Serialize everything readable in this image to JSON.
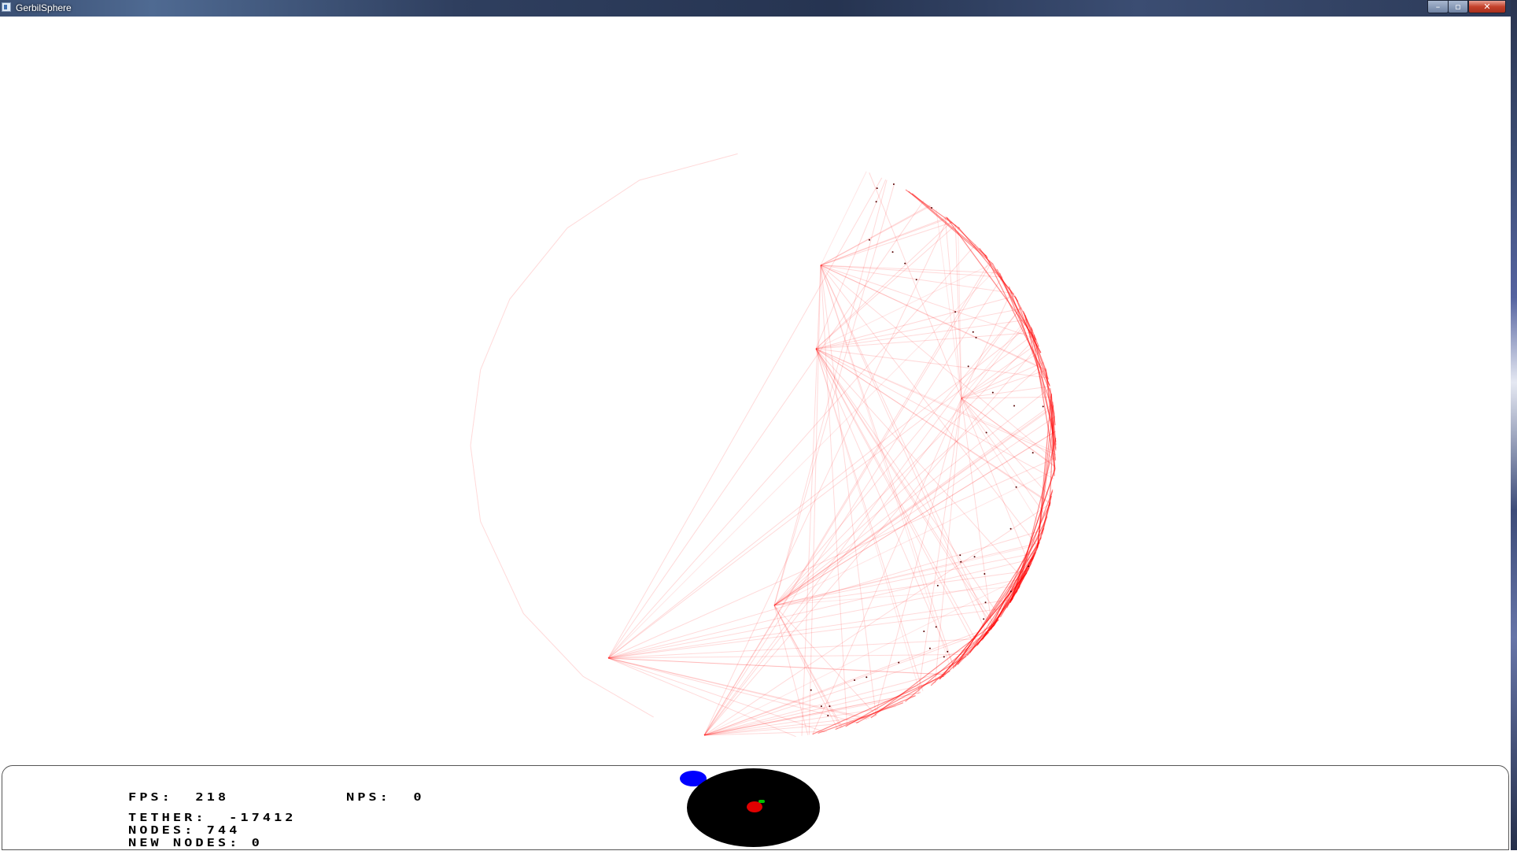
{
  "window": {
    "title": "GerbilSphere",
    "controls": {
      "minimize": "–",
      "maximize": "▫",
      "close": "✕"
    }
  },
  "colors": {
    "sphere_edge": "#ff0000",
    "hud_text": "#000000",
    "radar_background": "#000000",
    "camera_marker": "#0000ff",
    "radar_red": "#e00000",
    "radar_green": "#00c000"
  },
  "hud": {
    "fps_label": "FPS:",
    "fps_value": "218",
    "nps_label": "NPS:",
    "nps_value": "0",
    "tether_label": "TETHER:",
    "tether_value": "-17412",
    "nodes_label": "NODES:",
    "nodes_value": "744",
    "new_nodes_label": "NEW NODES:",
    "new_nodes_value": "0"
  }
}
